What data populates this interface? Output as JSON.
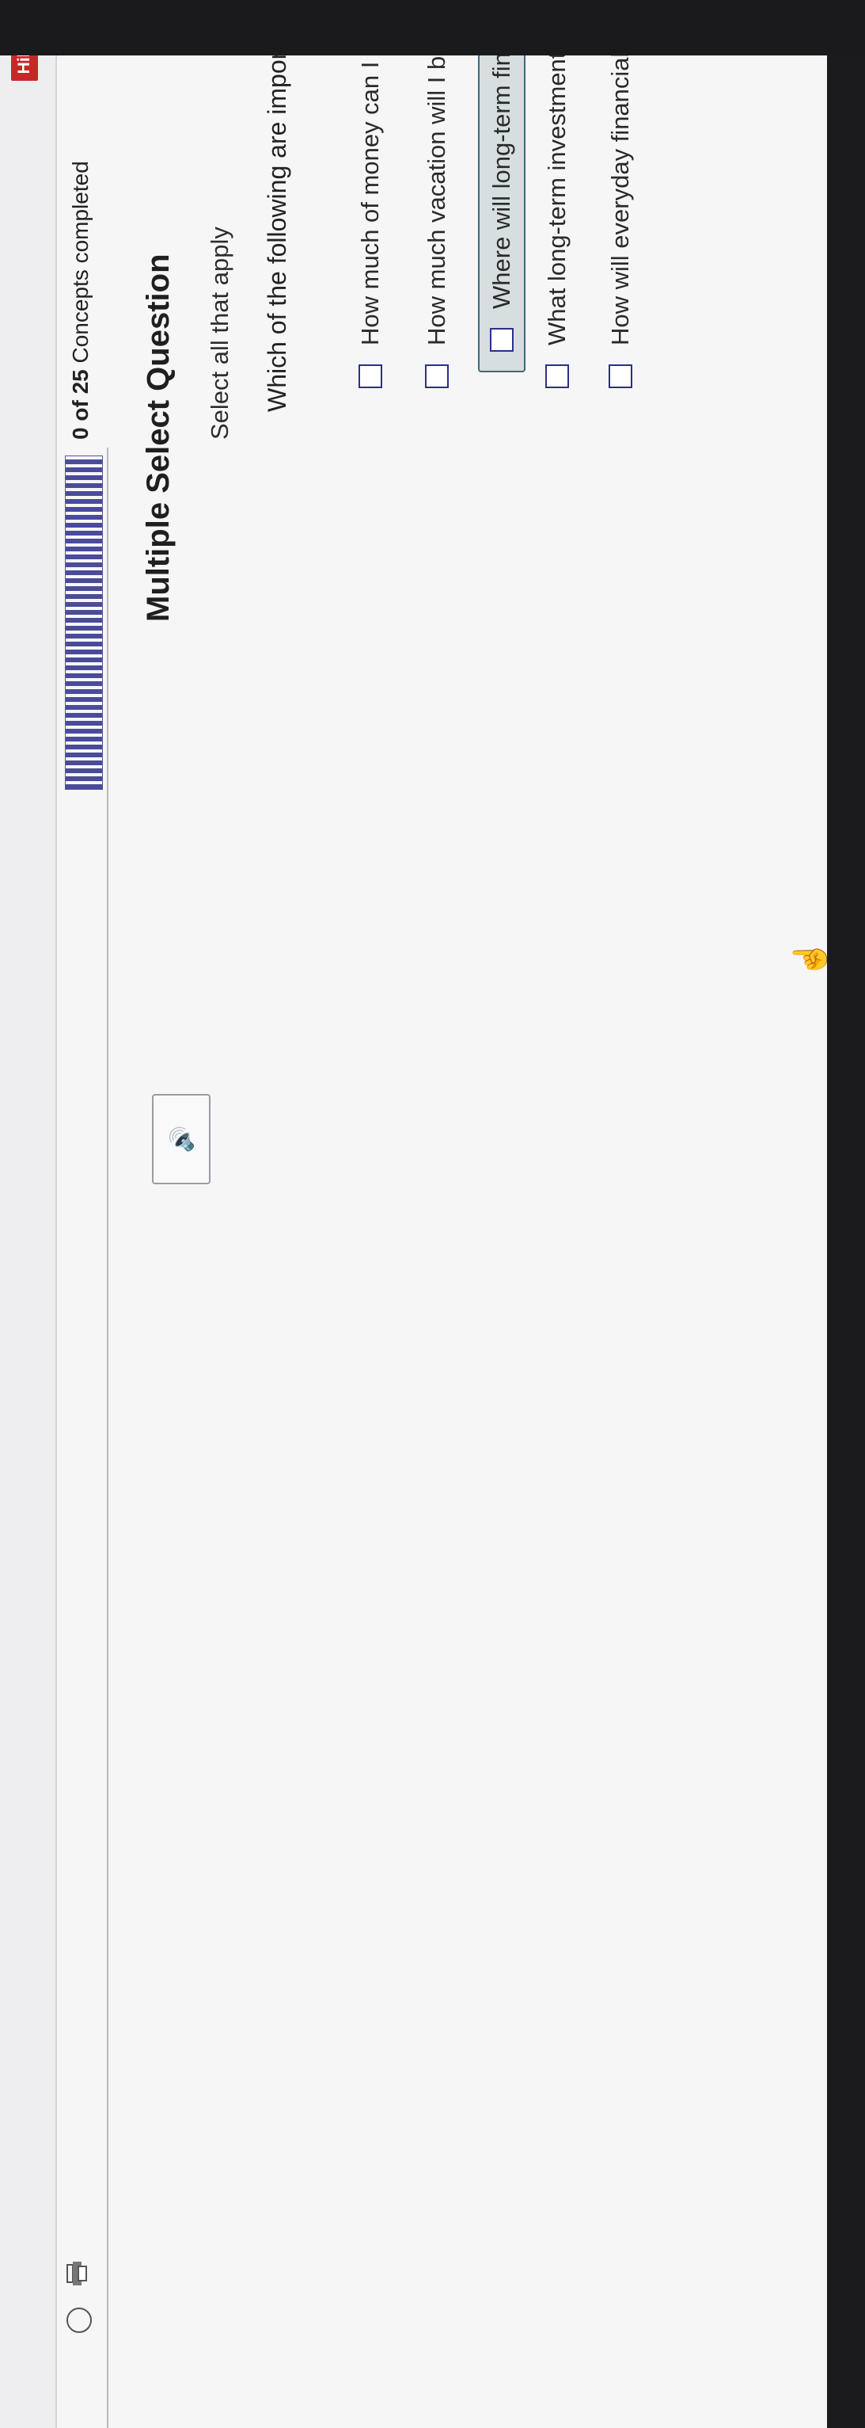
{
  "brand": {
    "logo_text": "Hill"
  },
  "progress": {
    "completed": "0",
    "total": "25",
    "of": "of",
    "suffix": "Concepts completed",
    "info_icon": "i",
    "fraction_complete": 0
  },
  "question": {
    "type": "Multiple Select Question",
    "instruction": "Select all that apply",
    "text": "Which of the following are important financial questions to be asked when starting a business? More than one answer may be correct."
  },
  "options": [
    {
      "label": "How much of money can I draw from the business for my personal use?",
      "checked": false
    },
    {
      "label": "How much vacation will I be able to take if I own my own business?",
      "checked": false
    },
    {
      "label": "Where will long-term financing be obtained to pay for investments?",
      "checked": false,
      "highlighted": true
    },
    {
      "label": "What long-term investments should be made?",
      "checked": false
    },
    {
      "label": "How will everyday financial activities be handled?",
      "checked": false
    }
  ],
  "icons": {
    "audio": "speaker-icon",
    "print": "printer-icon",
    "clock": "clock-icon",
    "info": "info-icon",
    "cursor": "hand-cursor-icon"
  },
  "colors": {
    "accent": "#2d2e8c",
    "highlight_bg": "#d6dedf",
    "highlight_border": "#3d6a78",
    "logo_red": "#c62828"
  }
}
